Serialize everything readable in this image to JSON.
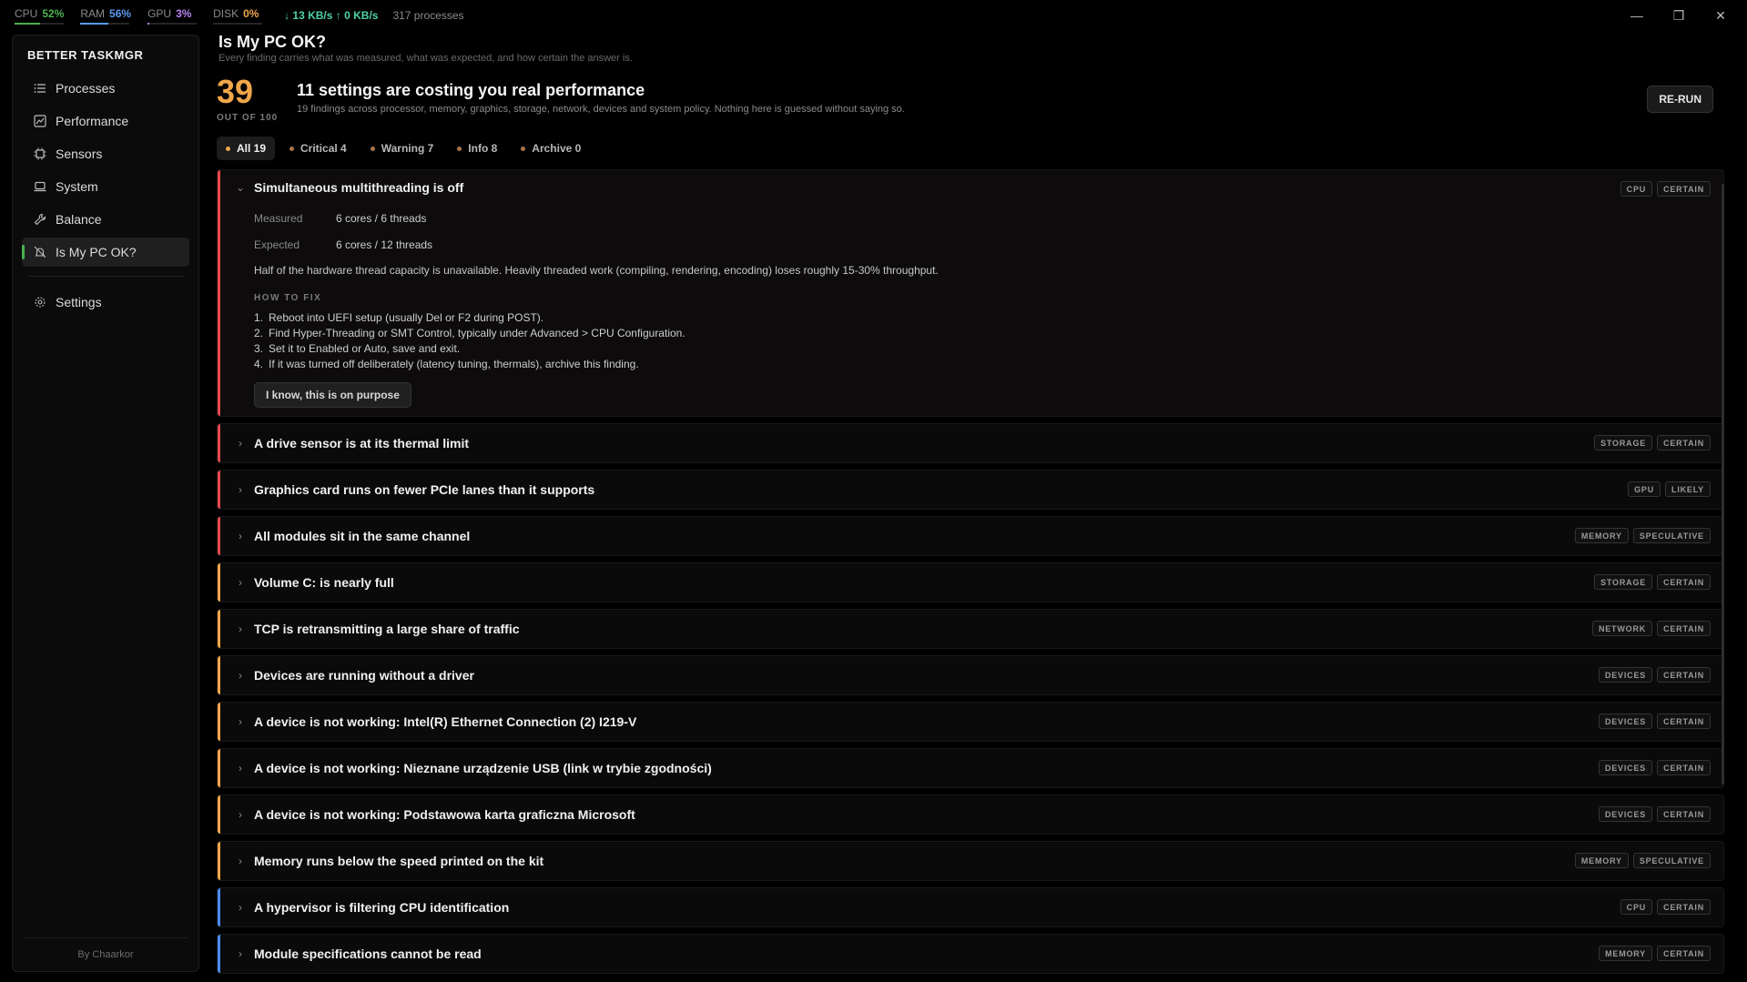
{
  "stats": {
    "cpu": {
      "label": "CPU",
      "value": "52%",
      "fill": 0.52,
      "color": "#4caf50"
    },
    "ram": {
      "label": "RAM",
      "value": "56%",
      "fill": 0.56,
      "color": "#5b9bf0"
    },
    "gpu": {
      "label": "GPU",
      "value": "3%",
      "fill": 0.03,
      "color": "#b784f0"
    },
    "disk": {
      "label": "DISK",
      "value": "0%",
      "fill": 0.0,
      "color": "#f0a64a"
    },
    "net": "↓ 13 KB/s  ↑ 0 KB/s",
    "processes": "317 processes"
  },
  "window": {
    "minimize": "—",
    "restore": "❐",
    "close": "✕"
  },
  "sidebar": {
    "brand": "BETTER TASKMGR",
    "items": [
      {
        "label": "Processes",
        "icon": "list-icon"
      },
      {
        "label": "Performance",
        "icon": "chart-icon"
      },
      {
        "label": "Sensors",
        "icon": "chip-icon"
      },
      {
        "label": "System",
        "icon": "laptop-icon"
      },
      {
        "label": "Balance",
        "icon": "wrench-icon"
      },
      {
        "label": "Is My PC OK?",
        "icon": "bell-off-icon",
        "active": true
      }
    ],
    "settings": "Settings",
    "footer": "By Chaarkor"
  },
  "header": {
    "title": "Is My PC OK?",
    "subtitle": "Every finding carries what was measured, what was expected, and how certain the answer is.",
    "score": "39",
    "score_of": "OUT OF 100",
    "headline": "11 settings are costing you real performance",
    "headline_sub": "19 findings across processor, memory, graphics, storage, network, devices and system policy. Nothing here is guessed without saying so.",
    "rerun": "RE-RUN"
  },
  "filters": [
    {
      "label": "All 19",
      "dot": "#f0a64a",
      "active": true
    },
    {
      "label": "Critical 4",
      "dot": "#f0a64a"
    },
    {
      "label": "Warning 7",
      "dot": "#f0a64a"
    },
    {
      "label": "Info 8",
      "dot": "#f0a64a"
    },
    {
      "label": "Archive 0",
      "dot": "#f0a64a"
    }
  ],
  "colors": {
    "critical": "#e5484d",
    "warning": "#f0a64a",
    "info": "#4a8cf0"
  },
  "expanded": {
    "title": "Simultaneous multithreading is off",
    "tags": [
      "CPU",
      "CERTAIN"
    ],
    "measured_label": "Measured",
    "measured": "6 cores / 6 threads",
    "expected_label": "Expected",
    "expected": "6 cores / 12 threads",
    "description": "Half of the hardware thread capacity is unavailable. Heavily threaded work (compiling, rendering, encoding) loses roughly 15-30% throughput.",
    "howto": "HOW TO FIX",
    "steps": [
      "Reboot into UEFI setup (usually Del or F2 during POST).",
      "Find Hyper-Threading or SMT Control, typically under Advanced > CPU Configuration.",
      "Set it to Enabled or Auto, save and exit.",
      "If it was turned off deliberately (latency tuning, thermals), archive this finding."
    ],
    "button": "I know, this is on purpose"
  },
  "findings": [
    {
      "title": "A drive sensor is at its thermal limit",
      "severity": "critical",
      "tags": [
        "STORAGE",
        "CERTAIN"
      ]
    },
    {
      "title": "Graphics card runs on fewer PCIe lanes than it supports",
      "severity": "critical",
      "tags": [
        "GPU",
        "LIKELY"
      ]
    },
    {
      "title": "All modules sit in the same channel",
      "severity": "critical",
      "tags": [
        "MEMORY",
        "SPECULATIVE"
      ]
    },
    {
      "title": "Volume C: is nearly full",
      "severity": "warning",
      "tags": [
        "STORAGE",
        "CERTAIN"
      ]
    },
    {
      "title": "TCP is retransmitting a large share of traffic",
      "severity": "warning",
      "tags": [
        "NETWORK",
        "CERTAIN"
      ]
    },
    {
      "title": "Devices are running without a driver",
      "severity": "warning",
      "tags": [
        "DEVICES",
        "CERTAIN"
      ]
    },
    {
      "title": "A device is not working: Intel(R) Ethernet Connection (2) I219-V",
      "severity": "warning",
      "tags": [
        "DEVICES",
        "CERTAIN"
      ]
    },
    {
      "title": "A device is not working: Nieznane urządzenie USB (link w trybie zgodności)",
      "severity": "warning",
      "tags": [
        "DEVICES",
        "CERTAIN"
      ]
    },
    {
      "title": "A device is not working: Podstawowa karta graficzna Microsoft",
      "severity": "warning",
      "tags": [
        "DEVICES",
        "CERTAIN"
      ]
    },
    {
      "title": "Memory runs below the speed printed on the kit",
      "severity": "warning",
      "tags": [
        "MEMORY",
        "SPECULATIVE"
      ]
    },
    {
      "title": "A hypervisor is filtering CPU identification",
      "severity": "info",
      "tags": [
        "CPU",
        "CERTAIN"
      ]
    },
    {
      "title": "Module specifications cannot be read",
      "severity": "info",
      "tags": [
        "MEMORY",
        "CERTAIN"
      ]
    }
  ]
}
